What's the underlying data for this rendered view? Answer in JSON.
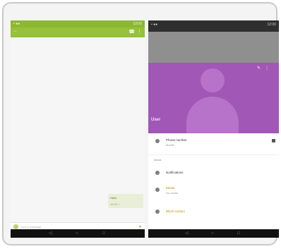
{
  "left_screen": {
    "status_bar": {
      "left_text": "• ●●",
      "right_text": "12:00"
    },
    "toolbar": {
      "title": "←",
      "icon_a": "☎",
      "icon_b": "⋮"
    },
    "message": {
      "text": "Hello",
      "time": "12:00 ✓"
    },
    "input": {
      "placeholder": "Type a message"
    },
    "send_icon": "➤",
    "nav": {
      "back": "◁",
      "home": "○",
      "recents": "□"
    }
  },
  "right_screen": {
    "status_bar": {
      "left_text": "• ●●",
      "right_text": "12:00"
    },
    "header": {
      "name": "User",
      "icon_edit": "✎",
      "icon_more": "⋮"
    },
    "rows": [
      {
        "title": "Phone number",
        "subtitle": "Mobile"
      },
      {
        "title": "Notifications",
        "subtitle": ""
      },
      {
        "title": "Media",
        "subtitle": "No media"
      },
      {
        "title": "Block contact",
        "subtitle": ""
      }
    ],
    "section_label": "About"
  },
  "colors": {
    "green": "#96c13a",
    "purple": "#a157b6",
    "gray": "#8f8f8f"
  }
}
